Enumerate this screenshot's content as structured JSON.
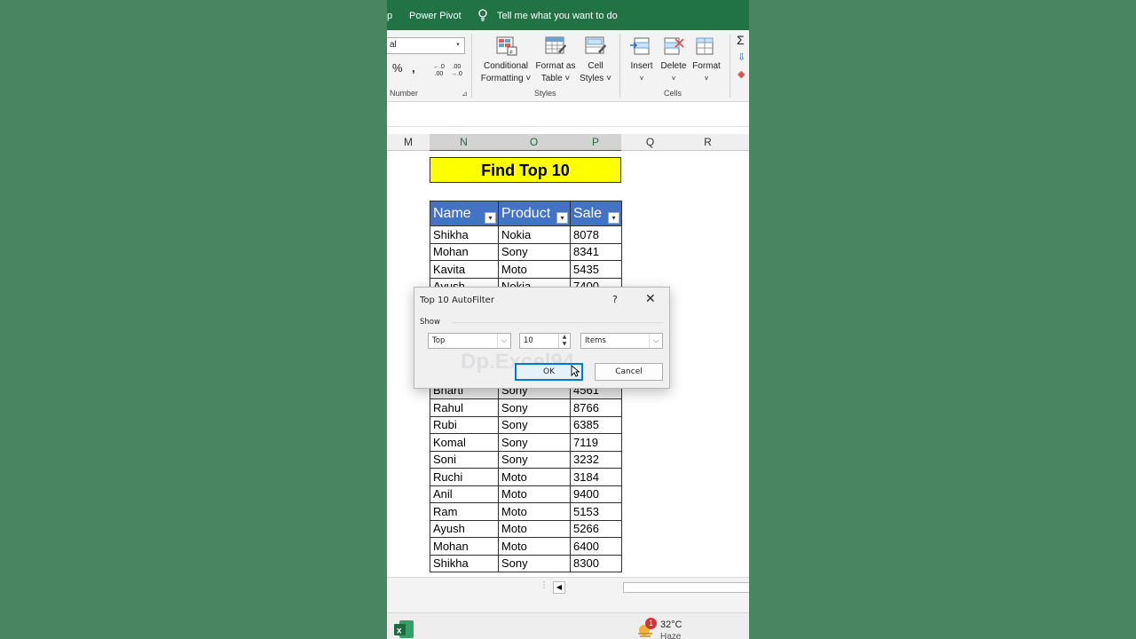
{
  "topbar": {
    "tab_cut": "p",
    "power_pivot": "Power Pivot",
    "tell_me": "Tell me what you want to do"
  },
  "ribbon": {
    "number_format": "al",
    "percent": "%",
    "comma": ",",
    "increase_decimal": "←.0\n.00",
    "decrease_decimal": ".00\n→.0",
    "number_group": "Number",
    "conditional_formatting": [
      "Conditional",
      "Formatting ˅"
    ],
    "format_as_table": [
      "Format as",
      "Table ˅"
    ],
    "cell_styles": [
      "Cell",
      "Styles ˅"
    ],
    "styles_group": "Styles",
    "insert": "Insert",
    "delete": "Delete",
    "format": "Format",
    "cells_group": "Cells",
    "sigma": "Σ"
  },
  "columns": [
    "M",
    "N",
    "O",
    "P",
    "Q",
    "R"
  ],
  "sheet": {
    "title": "Find Top 10",
    "headers": [
      "Name",
      "Product",
      "Sale"
    ],
    "rows_top": [
      [
        "Shikha",
        "Nokia",
        "8078"
      ],
      [
        "Mohan",
        "Sony",
        "8341"
      ],
      [
        "Kavita",
        "Moto",
        "5435"
      ],
      [
        "Ayush",
        "Nokia",
        "7400"
      ]
    ],
    "rows_bottom": [
      [
        "Bharti",
        "Sony",
        "4561"
      ],
      [
        "Rahul",
        "Sony",
        "8766"
      ],
      [
        "Rubi",
        "Sony",
        "6385"
      ],
      [
        "Komal",
        "Sony",
        "7119"
      ],
      [
        "Soni",
        "Sony",
        "3232"
      ],
      [
        "Ruchi",
        "Moto",
        "3184"
      ],
      [
        "Anil",
        "Moto",
        "9400"
      ],
      [
        "Ram",
        "Moto",
        "5153"
      ],
      [
        "Ayush",
        "Moto",
        "5266"
      ],
      [
        "Mohan",
        "Moto",
        "6400"
      ],
      [
        "Shikha",
        "Sony",
        "8300"
      ]
    ]
  },
  "dialog": {
    "title": "Top 10 AutoFilter",
    "help": "?",
    "close": "✕",
    "show_label": "Show",
    "type_value": "Top",
    "count_value": "10",
    "unit_value": "Items",
    "ok": "OK",
    "cancel": "Cancel",
    "watermark": "Dp.Excel94"
  },
  "taskbar": {
    "temperature": "32°C",
    "weather": "Haze",
    "badge": "1"
  }
}
